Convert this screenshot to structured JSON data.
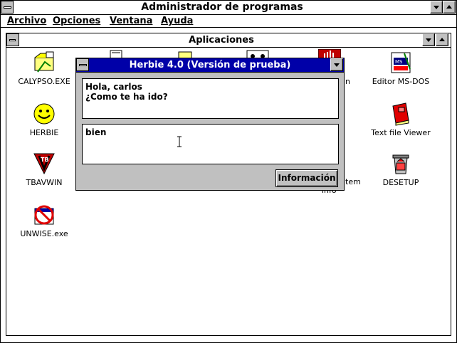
{
  "program_manager": {
    "title": "Administrador de programas",
    "menu": [
      "Archivo",
      "Opciones",
      "Ventana",
      "Ayuda"
    ]
  },
  "group": {
    "title": "Aplicaciones",
    "icons": [
      {
        "label": "CALYPSO.EXE",
        "icon": "calypso-icon"
      },
      {
        "label": "HERBIE",
        "icon": "smiley-icon"
      },
      {
        "label": "TBAVWIN",
        "icon": "tbav-icon"
      },
      {
        "label": "UNWISE.exe",
        "icon": "unwise-icon"
      },
      {
        "label": "Editor MS-DOS",
        "icon": "msdos-editor-icon"
      },
      {
        "label": "Text file Viewer",
        "icon": "book-icon"
      },
      {
        "label": "DESETUP",
        "icon": "recycle-bin-icon"
      },
      {
        "label": "tem",
        "icon": "partial-label"
      },
      {
        "label": "n",
        "icon": "partial-label"
      },
      {
        "label": "info",
        "icon": "partial-label"
      }
    ]
  },
  "dialog": {
    "title": "Herbie  4.0  (Versión de prueba)",
    "message": "Hola, carlos\n¿Como te ha ido?",
    "input_value": "bien",
    "info_button": "Información",
    "colors": {
      "titlebar": "#0000a8",
      "face": "#c0c0c0"
    }
  }
}
